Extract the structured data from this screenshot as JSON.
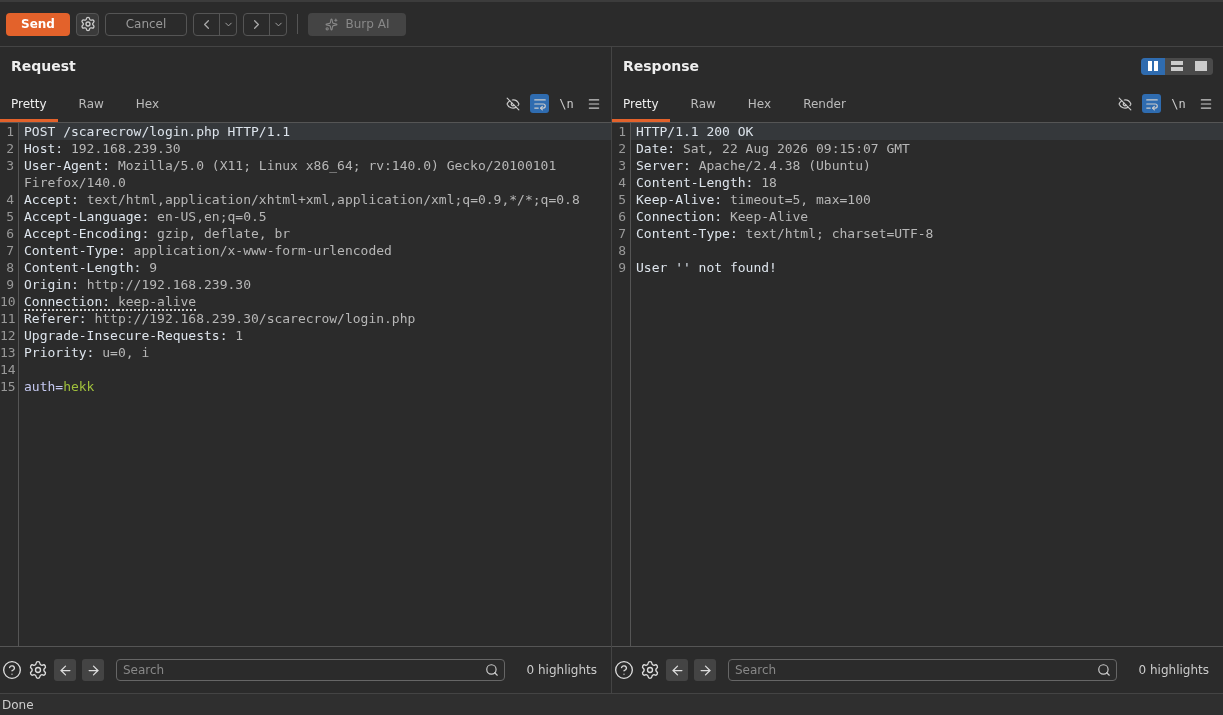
{
  "toolbar": {
    "send": "Send",
    "cancel": "Cancel",
    "ai": "Burp AI"
  },
  "panes": [
    {
      "title": "Request",
      "tabs": [
        {
          "label": "Pretty",
          "selected": true
        },
        {
          "label": "Raw",
          "selected": false
        },
        {
          "label": "Hex",
          "selected": false
        }
      ],
      "wrap_on": true,
      "newline_label": "\\n",
      "lines": [
        {
          "number": "1",
          "current": true,
          "flagged": false,
          "parts": [
            {
              "kind": "key",
              "text": "POST /scarecrow/login.php HTTP/1.1"
            }
          ]
        },
        {
          "number": "2",
          "current": false,
          "flagged": false,
          "parts": [
            {
              "kind": "key",
              "text": "Host: "
            },
            {
              "kind": "value",
              "text": "192.168.239.30"
            }
          ]
        },
        {
          "number": "3",
          "current": false,
          "flagged": false,
          "parts": [
            {
              "kind": "key",
              "text": "User-Agent: "
            },
            {
              "kind": "value",
              "text": "Mozilla/5.0 (X11; Linux x86_64; rv:140.0) Gecko/20100101 Firefox/140.0"
            }
          ]
        },
        {
          "number": "4",
          "current": false,
          "flagged": false,
          "parts": [
            {
              "kind": "key",
              "text": "Accept: "
            },
            {
              "kind": "value",
              "text": "text/html,application/xhtml+xml,application/xml;q=0.9,*/*;q=0.8"
            }
          ]
        },
        {
          "number": "5",
          "current": false,
          "flagged": false,
          "parts": [
            {
              "kind": "key",
              "text": "Accept-Language: "
            },
            {
              "kind": "value",
              "text": "en-US,en;q=0.5"
            }
          ]
        },
        {
          "number": "6",
          "current": false,
          "flagged": false,
          "parts": [
            {
              "kind": "key",
              "text": "Accept-Encoding: "
            },
            {
              "kind": "value",
              "text": "gzip, deflate, br"
            }
          ]
        },
        {
          "number": "7",
          "current": false,
          "flagged": false,
          "parts": [
            {
              "kind": "key",
              "text": "Content-Type: "
            },
            {
              "kind": "value",
              "text": "application/x-www-form-urlencoded"
            }
          ]
        },
        {
          "number": "8",
          "current": false,
          "flagged": false,
          "parts": [
            {
              "kind": "key",
              "text": "Content-Length: "
            },
            {
              "kind": "value",
              "text": "9"
            }
          ]
        },
        {
          "number": "9",
          "current": false,
          "flagged": false,
          "parts": [
            {
              "kind": "key",
              "text": "Origin: "
            },
            {
              "kind": "value",
              "text": "http://192.168.239.30"
            }
          ]
        },
        {
          "number": "10",
          "current": false,
          "flagged": true,
          "parts": [
            {
              "kind": "key",
              "text": "Connection: "
            },
            {
              "kind": "value",
              "text": "keep-alive"
            }
          ]
        },
        {
          "number": "11",
          "current": false,
          "flagged": false,
          "parts": [
            {
              "kind": "key",
              "text": "Referer: "
            },
            {
              "kind": "value",
              "text": "http://192.168.239.30/scarecrow/login.php"
            }
          ]
        },
        {
          "number": "12",
          "current": false,
          "flagged": false,
          "parts": [
            {
              "kind": "key",
              "text": "Upgrade-Insecure-Requests: "
            },
            {
              "kind": "value",
              "text": "1"
            }
          ]
        },
        {
          "number": "13",
          "current": false,
          "flagged": false,
          "parts": [
            {
              "kind": "key",
              "text": "Priority: "
            },
            {
              "kind": "value",
              "text": "u=0, i"
            }
          ]
        },
        {
          "number": "14",
          "current": false
        },
        {
          "number": "15",
          "current": false,
          "flagged": false,
          "parts": [
            {
              "kind": "param",
              "text": "auth="
            },
            {
              "kind": "param_value",
              "text": "hekk"
            }
          ]
        }
      ],
      "search": {
        "placeholder": "Search"
      },
      "highlights": "0 highlights"
    },
    {
      "title": "Response",
      "layouts": [
        {
          "selected": true
        },
        {
          "selected": false
        },
        {
          "selected": false
        }
      ],
      "tabs": [
        {
          "label": "Pretty",
          "selected": true
        },
        {
          "label": "Raw",
          "selected": false
        },
        {
          "label": "Hex",
          "selected": false
        },
        {
          "label": "Render",
          "selected": false
        }
      ],
      "wrap_on": true,
      "newline_label": "\\n",
      "lines": [
        {
          "number": "1",
          "current": true,
          "flagged": false,
          "parts": [
            {
              "kind": "key",
              "text": "HTTP/1.1 200 OK"
            }
          ]
        },
        {
          "number": "2",
          "current": false,
          "flagged": false,
          "parts": [
            {
              "kind": "key",
              "text": "Date: "
            },
            {
              "kind": "value",
              "text": "Sat, 22 Aug 2026 09:15:07 GMT"
            }
          ]
        },
        {
          "number": "3",
          "current": false,
          "flagged": false,
          "parts": [
            {
              "kind": "key",
              "text": "Server: "
            },
            {
              "kind": "value",
              "text": "Apache/2.4.38 (Ubuntu)"
            }
          ]
        },
        {
          "number": "4",
          "current": false,
          "flagged": false,
          "parts": [
            {
              "kind": "key",
              "text": "Content-Length: "
            },
            {
              "kind": "value",
              "text": "18"
            }
          ]
        },
        {
          "number": "5",
          "current": false,
          "flagged": false,
          "parts": [
            {
              "kind": "key",
              "text": "Keep-Alive: "
            },
            {
              "kind": "value",
              "text": "timeout=5, max=100"
            }
          ]
        },
        {
          "number": "6",
          "current": false,
          "flagged": false,
          "parts": [
            {
              "kind": "key",
              "text": "Connection: "
            },
            {
              "kind": "value",
              "text": "Keep-Alive"
            }
          ]
        },
        {
          "number": "7",
          "current": false,
          "flagged": false,
          "parts": [
            {
              "kind": "key",
              "text": "Content-Type: "
            },
            {
              "kind": "value",
              "text": "text/html; charset=UTF-8"
            }
          ]
        },
        {
          "number": "8",
          "current": false
        },
        {
          "number": "9",
          "current": false,
          "flagged": false,
          "parts": [
            {
              "kind": "key",
              "text": "User '' not found!"
            }
          ]
        }
      ],
      "search": {
        "placeholder": "Search"
      },
      "highlights": "0 highlights"
    }
  ],
  "status_bar": "Done"
}
